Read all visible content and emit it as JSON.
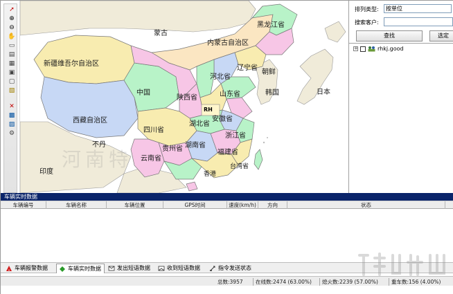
{
  "toolbar": {
    "icons": [
      "pointer-icon",
      "zoom-in-icon",
      "zoom-out-icon",
      "pan-icon",
      "measure-icon",
      "layer-icon",
      "print-icon",
      "grid-icon",
      "select-icon",
      "window-icon",
      "route-icon",
      "vehicle-icon",
      "export-icon",
      "settings-icon"
    ]
  },
  "map": {
    "labels": {
      "mongolia": "蒙古",
      "heilongjiang": "黑龙江省",
      "innermongolia": "内蒙古自治区",
      "xinjiang": "新疆维吾尔自治区",
      "liaoning": "辽宁省",
      "northkorea": "朝鲜",
      "hebei": "河北省",
      "china": "中国",
      "shaanxi": "陕西省",
      "shandong": "山东省",
      "korea": "韩国",
      "japan": "日本",
      "tibet": "西藏自治区",
      "hubei": "湖北省",
      "anhui": "安徽省",
      "sichuan": "四川省",
      "zhejiang": "浙江省",
      "bhutan": "不丹",
      "guizhou": "贵州省",
      "hunan": "湖南省",
      "fujian": "福建省",
      "yunnan": "云南省",
      "taiwan": "台湾省",
      "india": "印度",
      "hongkong": "香港",
      "marker": "RH"
    }
  },
  "right_panel": {
    "sort_label": "排列类型:",
    "sort_value": "按单位",
    "search_label": "搜索客户:",
    "search_value": "",
    "find_button": "查找",
    "select_button": "选定",
    "tree_expander": "+",
    "tree_item": "rhkj.good"
  },
  "data_panel": {
    "title": "车辆实时数据",
    "columns": [
      "车辆编号",
      "车辆名称",
      "车辆位置",
      "GPS时间",
      "速度(km/h)",
      "方向",
      "状态"
    ]
  },
  "tabs": [
    {
      "label": "车辆报警数据",
      "active": false
    },
    {
      "label": "车辆实时数据",
      "active": true
    },
    {
      "label": "发出短语数据",
      "active": false
    },
    {
      "label": "收到短语数据",
      "active": false
    },
    {
      "label": "指令发送状态",
      "active": false
    }
  ],
  "status": {
    "total": "总数:3957",
    "online": "在线数:2474 (63.00%)",
    "offline": "熄火数:2239 (57.00%)",
    "stopped": "重车数:156 (4.00%)"
  },
  "colors": {
    "titlebar": "#0a246a",
    "sea": "#ffffff",
    "land_pink": "#f7c6e6",
    "land_green": "#b8f3c8",
    "land_yellow": "#f8ecb0",
    "land_blue": "#c7d8f5",
    "land_tan": "#fbe6c2",
    "neighbor": "#f0ebd9"
  }
}
